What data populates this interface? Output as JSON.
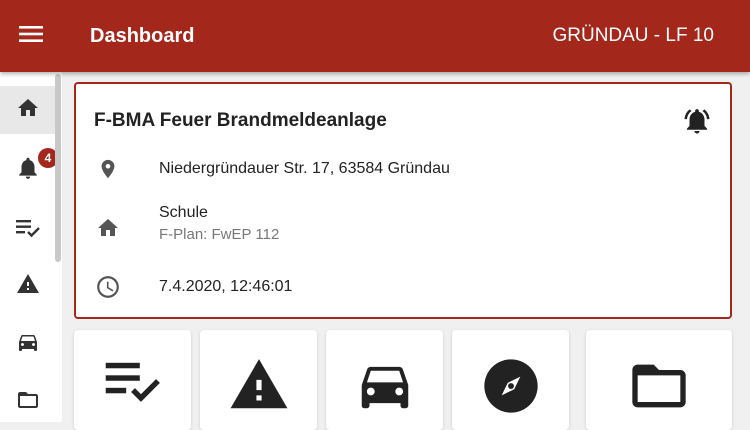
{
  "header": {
    "title": "Dashboard",
    "unit": "GRÜNDAU - LF 10",
    "menu_icon": "menu-icon"
  },
  "sidebar": {
    "items": [
      {
        "name": "home",
        "icon": "home-icon",
        "active": true
      },
      {
        "name": "alarms",
        "icon": "bell-icon",
        "badge": "4"
      },
      {
        "name": "checklist",
        "icon": "checklist-icon"
      },
      {
        "name": "warning",
        "icon": "warning-icon"
      },
      {
        "name": "vehicles",
        "icon": "car-icon"
      },
      {
        "name": "folder",
        "icon": "folder-icon"
      }
    ]
  },
  "incident": {
    "title": "F-BMA Feuer Brandmeldeanlage",
    "address": "Niedergründauer Str. 17, 63584 Gründau",
    "object": "Schule",
    "plan": "F-Plan: FwEP 112",
    "time": "7.4.2020, 12:46:01"
  },
  "tiles": [
    {
      "icon": "checklist-icon"
    },
    {
      "icon": "warning-icon"
    },
    {
      "icon": "car-icon"
    },
    {
      "icon": "compass-icon"
    },
    {
      "icon": "folder-icon"
    }
  ],
  "colors": {
    "brand": "#a3271b",
    "icon": "#333333"
  }
}
